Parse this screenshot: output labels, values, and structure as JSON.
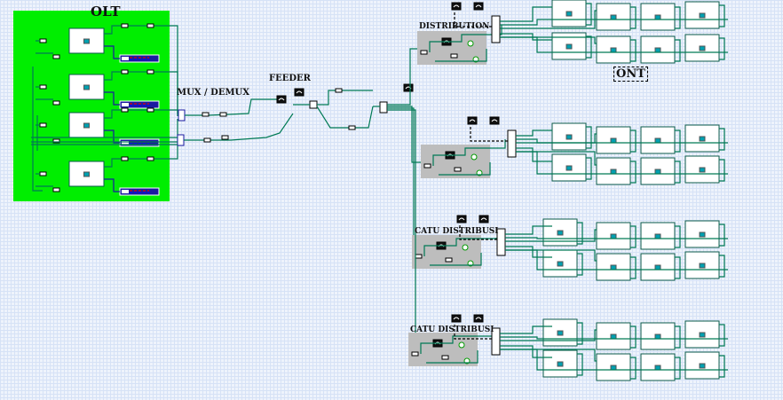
{
  "labels": {
    "olt": "OLT",
    "mux": "MUX / DEMUX",
    "feeder": "FEEDER",
    "distribution": "DISTRIBUTION",
    "ont": "ONT",
    "catu1": "CATU DISTRIBUSI",
    "catu2": "CATU DISTRIBUSI"
  },
  "colors": {
    "olt_area": "#00ee00",
    "wire": "#007a55",
    "distribution_area": "#bdbdbd",
    "transmitter": "#1a1aa0",
    "component_port": "#00a0b0"
  }
}
